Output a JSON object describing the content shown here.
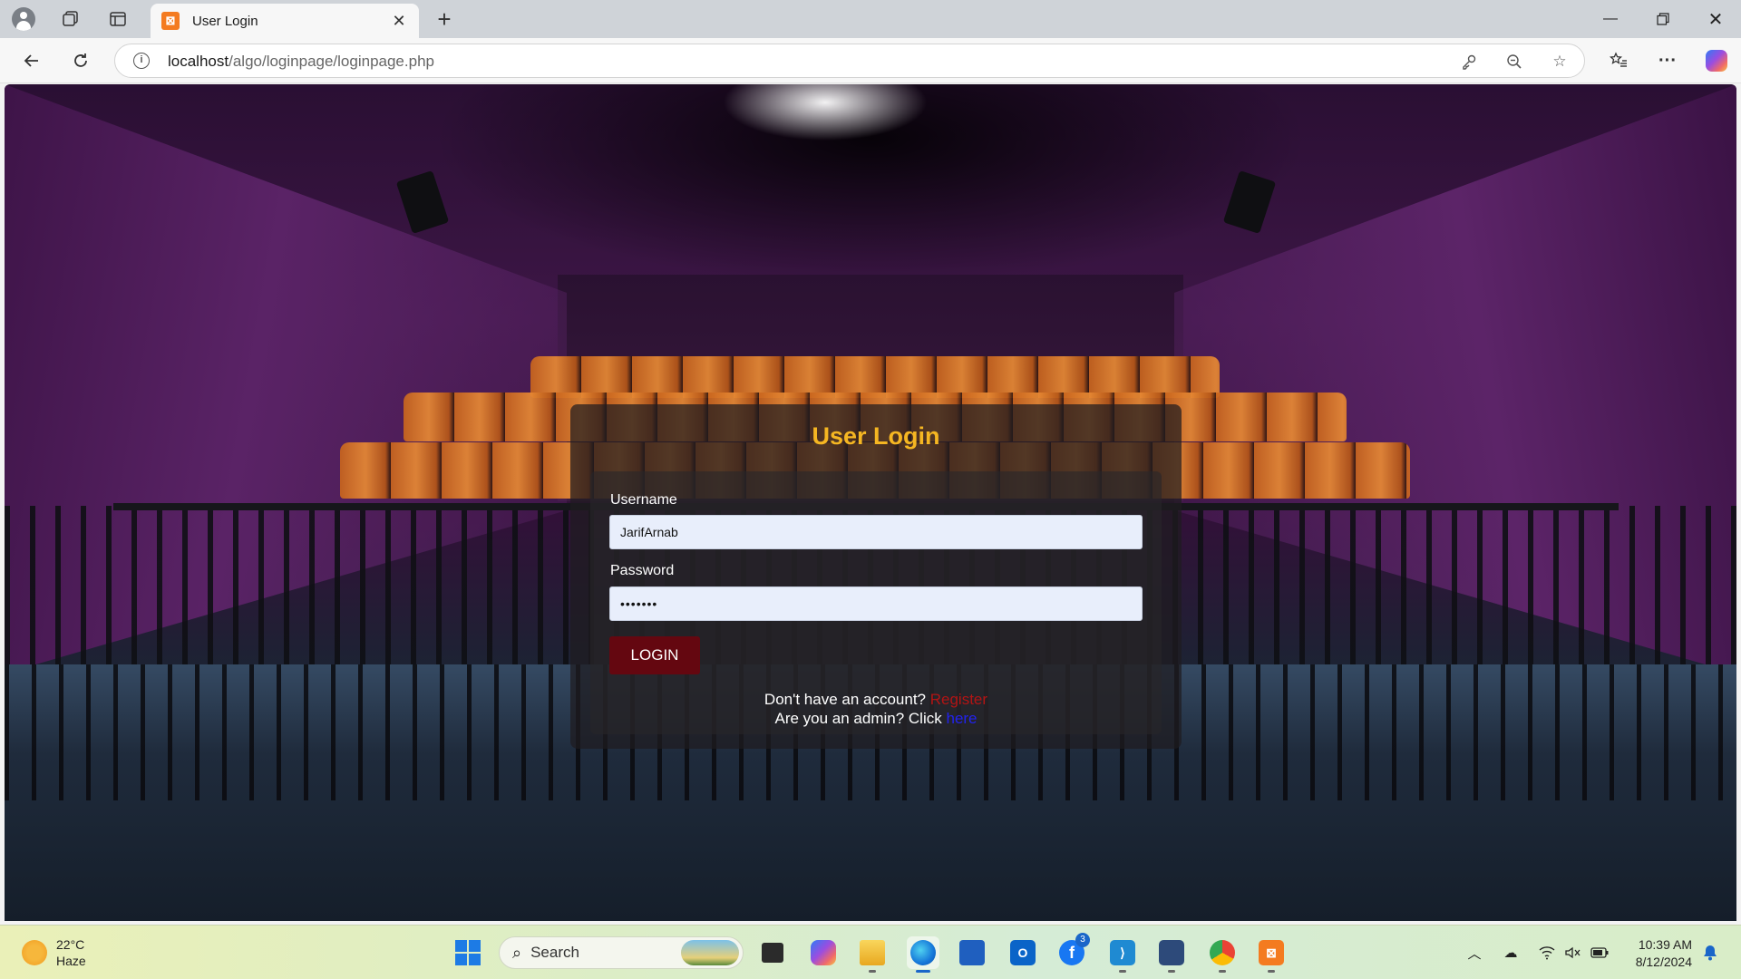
{
  "browser": {
    "tab_title": "User Login",
    "tab_favicon_glyph": "⊠",
    "url_host": "localhost",
    "url_path": "/algo/loginpage/loginpage.php",
    "icons": [
      "profile-icon",
      "workspaces-icon",
      "tab-actions-icon",
      "close-icon",
      "new-tab-icon",
      "minimize-icon",
      "restore-icon",
      "back-icon",
      "reload-icon",
      "info-icon",
      "key-icon",
      "zoom-out-icon",
      "favorite-star-icon",
      "favorites-icon",
      "more-icon",
      "copilot-icon"
    ]
  },
  "login": {
    "title": "User Login",
    "username_label": "Username",
    "username_value": "JarifArnab",
    "password_label": "Password",
    "password_value": "•••••••",
    "button_label": "LOGIN",
    "register_prompt": "Don't have an account?",
    "register_link": "Register",
    "admin_prompt": "Are you an admin? Click",
    "admin_link": "here"
  },
  "colors": {
    "title": "#f5b622",
    "login_button": "#640710",
    "register_link": "#b31414",
    "admin_link": "#2222ee",
    "input_bg": "#e8eefb"
  },
  "taskbar": {
    "weather_temp": "22°C",
    "weather_desc": "Haze",
    "search_placeholder": "Search",
    "facebook_badge": "3",
    "time": "10:39 AM",
    "date": "8/12/2024",
    "apps": [
      "start",
      "search",
      "task-view",
      "copilot",
      "file-explorer",
      "edge",
      "microsoft-store",
      "outlook",
      "facebook",
      "vscode",
      "virtualbox",
      "chrome",
      "xampp"
    ]
  }
}
